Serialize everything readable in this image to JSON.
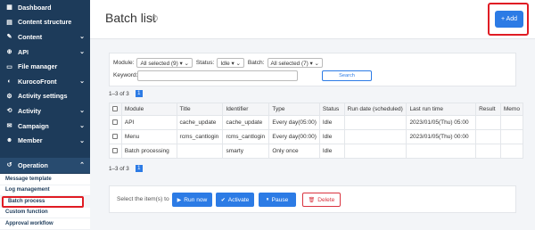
{
  "sidebar": {
    "items": [
      {
        "label": "Dashboard",
        "icon": "dashboard-icon",
        "glyph": "▦",
        "chevron": false
      },
      {
        "label": "Content structure",
        "icon": "structure-icon",
        "glyph": "▤",
        "chevron": false
      },
      {
        "label": "Content",
        "icon": "content-icon",
        "glyph": "✎",
        "chevron": true
      },
      {
        "label": "API",
        "icon": "api-icon",
        "glyph": "⊕",
        "chevron": true
      },
      {
        "label": "File manager",
        "icon": "folder-icon",
        "glyph": "▭",
        "chevron": false
      },
      {
        "label": "KurocoFront",
        "icon": "front-icon",
        "glyph": "◐",
        "chevron": true
      },
      {
        "label": "Activity settings",
        "icon": "settings-icon",
        "glyph": "⚙",
        "chevron": false
      },
      {
        "label": "Activity",
        "icon": "activity-icon",
        "glyph": "⟲",
        "chevron": true
      },
      {
        "label": "Campaign",
        "icon": "campaign-icon",
        "glyph": "✉",
        "chevron": true
      },
      {
        "label": "Member",
        "icon": "member-icon",
        "glyph": "☻",
        "chevron": true
      },
      {
        "label": "Operation",
        "icon": "operation-icon",
        "glyph": "↺",
        "chevron": true
      }
    ],
    "operation_sub": [
      "Message template",
      "Log management",
      "Batch process",
      "Custom function",
      "Approval workflow"
    ]
  },
  "header": {
    "title": "Batch list",
    "help": "?",
    "add_label": "+ Add"
  },
  "filters": {
    "module_label": "Module:",
    "module_value": "All selected (9) ▾ ⌄",
    "status_label": "Status:",
    "status_value": "Idle ▾ ⌄",
    "batch_label": "Batch:",
    "batch_value": "All selected (7) ▾ ⌄",
    "keyword_label": "Keyword:",
    "keyword_value": "",
    "search_label": "Search"
  },
  "pager": {
    "range": "1–3 of 3",
    "page": "1"
  },
  "table": {
    "headers": [
      "",
      "Module",
      "Title",
      "Identifier",
      "Type",
      "Status",
      "Run date (scheduled)",
      "Last run time",
      "Result",
      "Memo"
    ],
    "rows": [
      [
        "",
        "API",
        "cache_update",
        "cache_update",
        "Every day(05:00)",
        "Idle",
        "",
        "2023/01/05(Thu) 05:00",
        "",
        ""
      ],
      [
        "",
        "Menu",
        "rcms_cantlogin",
        "rcms_cantlogin",
        "Every day(00:00)",
        "Idle",
        "",
        "2023/01/05(Thu) 00:00",
        "",
        ""
      ],
      [
        "",
        "Batch processing",
        "",
        "smarty",
        "Only once",
        "Idle",
        "",
        "",
        "",
        ""
      ]
    ]
  },
  "actions": {
    "label": "Select the item(s) to",
    "run_now": "Run now",
    "activate": "Activate",
    "pause": "Pause",
    "delete": "Delete"
  }
}
